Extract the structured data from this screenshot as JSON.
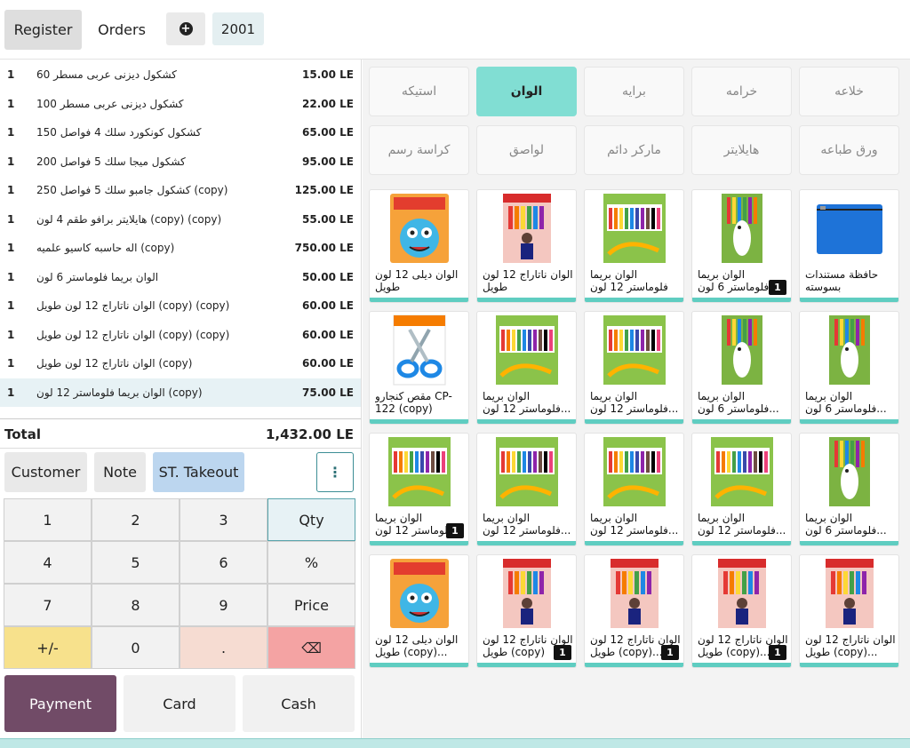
{
  "topbar": {
    "register": "Register",
    "orders": "Orders",
    "plus_icon": "+",
    "order_number": "2001"
  },
  "orderlines": [
    {
      "qty": "1",
      "name": "كشكول ديزنى عربى مسطر 60",
      "price": "15.00 LE"
    },
    {
      "qty": "1",
      "name": "كشكول ديزنى عربى مسطر 100",
      "price": "22.00 LE"
    },
    {
      "qty": "1",
      "name": "كشكول كونكورد سلك 4 فواصل 150",
      "price": "65.00 LE"
    },
    {
      "qty": "1",
      "name": "كشكول ميجا سلك 5 فواصل 200",
      "price": "95.00 LE"
    },
    {
      "qty": "1",
      "name": "كشكول جامبو سلك 5 فواصل 250 (copy)",
      "price": "125.00 LE"
    },
    {
      "qty": "1",
      "name": "هايلايتر برافو طقم 4 لون (copy) (copy)",
      "price": "55.00 LE"
    },
    {
      "qty": "1",
      "name": "اله حاسبه كاسيو علميه (copy)",
      "price": "750.00 LE"
    },
    {
      "qty": "1",
      "name": "الوان بريما فلوماستر 6 لون",
      "price": "50.00 LE"
    },
    {
      "qty": "1",
      "name": "الوان ناتاراج 12 لون طويل (copy) (copy)",
      "price": "60.00 LE"
    },
    {
      "qty": "1",
      "name": "الوان ناتاراج 12 لون طويل (copy) (copy)",
      "price": "60.00 LE"
    },
    {
      "qty": "1",
      "name": "الوان ناتاراج 12 لون طويل (copy)",
      "price": "60.00 LE"
    },
    {
      "qty": "1",
      "name": "الوان بريما فلوماستر 12 لون (copy)",
      "price": "75.00 LE"
    }
  ],
  "total": {
    "label": "Total",
    "value": "1,432.00 LE"
  },
  "actions": {
    "customer": "Customer",
    "note": "Note",
    "takeout": "ST. Takeout",
    "more_icon": "⋮"
  },
  "numpad": [
    "1",
    "2",
    "3",
    "Qty",
    "4",
    "5",
    "6",
    "%",
    "7",
    "8",
    "9",
    "Price",
    "+/-",
    "0",
    ".",
    "⌫"
  ],
  "payment": {
    "payment": "Payment",
    "card": "Card",
    "cash": "Cash"
  },
  "categories": [
    "استيكه",
    "الوان",
    "برايه",
    "خرامه",
    "خلاعه",
    "كراسة رسم",
    "لواصق",
    "ماركر دائم",
    "هايلايتر",
    "ورق طباعه"
  ],
  "products": [
    {
      "name": "الوان ديلى 12 لون طويل",
      "badge": "",
      "img": "deli"
    },
    {
      "name": "الوان ناتاراج 12 لون طويل",
      "badge": "",
      "img": "nataraj"
    },
    {
      "name": "الوان بريما فلوماستر 12 لون",
      "badge": "",
      "img": "box"
    },
    {
      "name": "الوان بريما فلوماستر 6 لون",
      "badge": "1",
      "img": "fish"
    },
    {
      "name": "حافظة مستندات بسوسته",
      "badge": "",
      "img": "folder"
    },
    {
      "name": "مقص كنجارو CP-122 (copy)",
      "badge": "",
      "img": "scissors"
    },
    {
      "name": "الوان بريما فلوماستر 12 لون...",
      "badge": "",
      "img": "box"
    },
    {
      "name": "الوان بريما فلوماستر 12 لون...",
      "badge": "",
      "img": "box"
    },
    {
      "name": "الوان بريما فلوماستر 6 لون...",
      "badge": "",
      "img": "fish"
    },
    {
      "name": "الوان بريما فلوماستر 6 لون...",
      "badge": "",
      "img": "fish"
    },
    {
      "name": "الوان بريما فلوماستر 12 لون",
      "badge": "1",
      "img": "box"
    },
    {
      "name": "الوان بريما فلوماستر 12 لون...",
      "badge": "",
      "img": "box"
    },
    {
      "name": "الوان بريما فلوماستر 12 لون...",
      "badge": "",
      "img": "box"
    },
    {
      "name": "الوان بريما فلوماستر 12 لون...",
      "badge": "",
      "img": "box"
    },
    {
      "name": "الوان بريما فلوماستر 6 لون...",
      "badge": "",
      "img": "fish"
    },
    {
      "name": "الوان ديلى 12 لون طويل (copy)...",
      "badge": "",
      "img": "deli"
    },
    {
      "name": "الوان ناتاراج 12 لون طويل (copy)",
      "badge": "1",
      "img": "nataraj"
    },
    {
      "name": "الوان ناتاراج 12 لون طويل (copy)...",
      "badge": "1",
      "img": "nataraj"
    },
    {
      "name": "الوان ناتاراج 12 لون طويل (copy)...",
      "badge": "1",
      "img": "nataraj"
    },
    {
      "name": "الوان ناتاراج 12 لون طويل (copy)...",
      "badge": "",
      "img": "nataraj"
    }
  ],
  "colors": {
    "accent": "#714b67",
    "active_category": "#81ded3",
    "product_bar": "#5fcdc1",
    "takeout": "#bcd6ef"
  }
}
